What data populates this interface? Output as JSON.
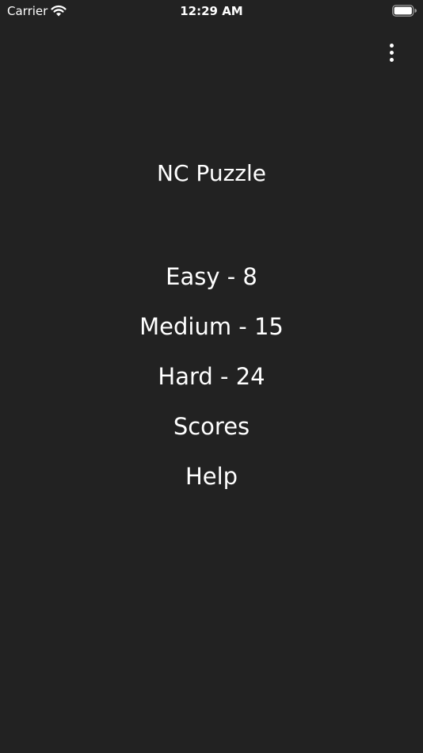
{
  "status_bar": {
    "carrier": "Carrier",
    "time": "12:29 AM",
    "wifi_icon": "wifi-icon",
    "battery_icon": "battery-icon"
  },
  "toolbar": {
    "overflow_icon": "more-vertical-icon"
  },
  "app": {
    "title": "NC Puzzle"
  },
  "menu": {
    "items": [
      {
        "label": "Easy - 8"
      },
      {
        "label": "Medium - 15"
      },
      {
        "label": "Hard - 24"
      },
      {
        "label": "Scores"
      },
      {
        "label": "Help"
      }
    ]
  },
  "colors": {
    "background": "#222222",
    "text": "#ffffff"
  }
}
